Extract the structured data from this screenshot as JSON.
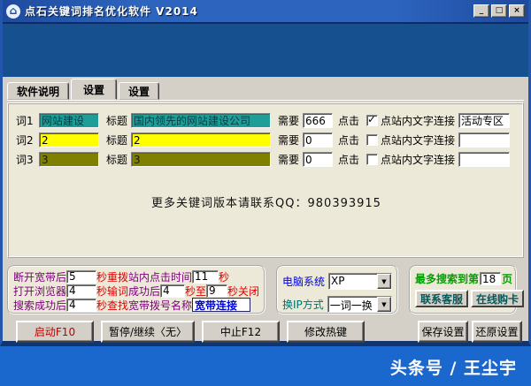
{
  "colors": {
    "titlebar_blue": "#2D64BE",
    "banner_blue": "#17508F",
    "desktop_blue": "#1A67CE",
    "chrome_gray": "#D4D0C8",
    "panel_cream": "#ECE9D8",
    "teal_field": "#1F9E97",
    "yellow_field": "#FFFF00",
    "olive_field": "#7F7F00",
    "label_purple": "#800080",
    "label_red": "#E00000",
    "label_blue": "#0000E0",
    "label_teal": "#007070",
    "label_green": "#00A000",
    "start_button_red": "#C00000",
    "dial_text_blue": "#0008D0"
  },
  "icons": {
    "app_icon": "⌂",
    "minimize": "_",
    "maximize": "□",
    "close": "×",
    "dropdown_arrow": "▼",
    "check": "✓"
  },
  "window": {
    "title": "点石关键词排名优化软件 V2014"
  },
  "tabs": [
    {
      "label": "软件说明",
      "active": false
    },
    {
      "label": "设置",
      "active": true
    },
    {
      "label": "设置",
      "active": false
    }
  ],
  "keywords": {
    "rows": [
      {
        "word_label": "词1",
        "word_value": "网站建设",
        "title_label": "标题",
        "title_value": "国内领先的网站建设公司",
        "need_label": "需要",
        "need_value": "666",
        "click_label": "点击",
        "link_label": "点站内文字连接",
        "link_checked": true,
        "link_value": "活动专区"
      },
      {
        "word_label": "词2",
        "word_value": "2",
        "title_label": "标题",
        "title_value": "2",
        "need_label": "需要",
        "need_value": "0",
        "click_label": "点击",
        "link_label": "点站内文字连接",
        "link_checked": false,
        "link_value": ""
      },
      {
        "word_label": "词3",
        "word_value": "3",
        "title_label": "标题",
        "title_value": "3",
        "need_label": "需要",
        "need_value": "0",
        "click_label": "点击",
        "link_label": "点站内文字连接",
        "link_checked": false,
        "link_value": ""
      }
    ]
  },
  "notice": "更多关键词版本请联系QQ：980393915",
  "timing": {
    "disconnect_label": "断开宽带后",
    "disconnect_value": "5",
    "disconnect_suffix": "秒重拨",
    "browser_label": "打开浏览器",
    "browser_value": "4",
    "browser_suffix": "秒输词",
    "search_label": "搜索成功后",
    "search_value": "4",
    "search_suffix": "秒查找",
    "site_click_label": "站内点击时间",
    "site_click_value": "11",
    "site_click_suffix": "秒",
    "success_label": "成功后",
    "success_value": "4",
    "success_mid": "秒至",
    "success_value2": "9",
    "success_suffix": "秒关闭",
    "dial_label": "宽带拨号名称",
    "dial_value": "宽带连接"
  },
  "system": {
    "os_label": "电脑系统",
    "os_value": "XP",
    "ip_label": "换IP方式",
    "ip_value": "一词一换"
  },
  "search": {
    "max_label": "最多搜索到第",
    "max_value": "18",
    "max_suffix": "页",
    "contact_button": "联系客服",
    "buy_button": "在线购卡"
  },
  "actions": {
    "start": "启动F10",
    "pause": "暂停/继续〈无〉",
    "stop": "中止F12",
    "hotkey": "修改热键",
    "save": "保存设置",
    "restore": "还原设置"
  },
  "watermark": "头条号 / 王尘宇"
}
